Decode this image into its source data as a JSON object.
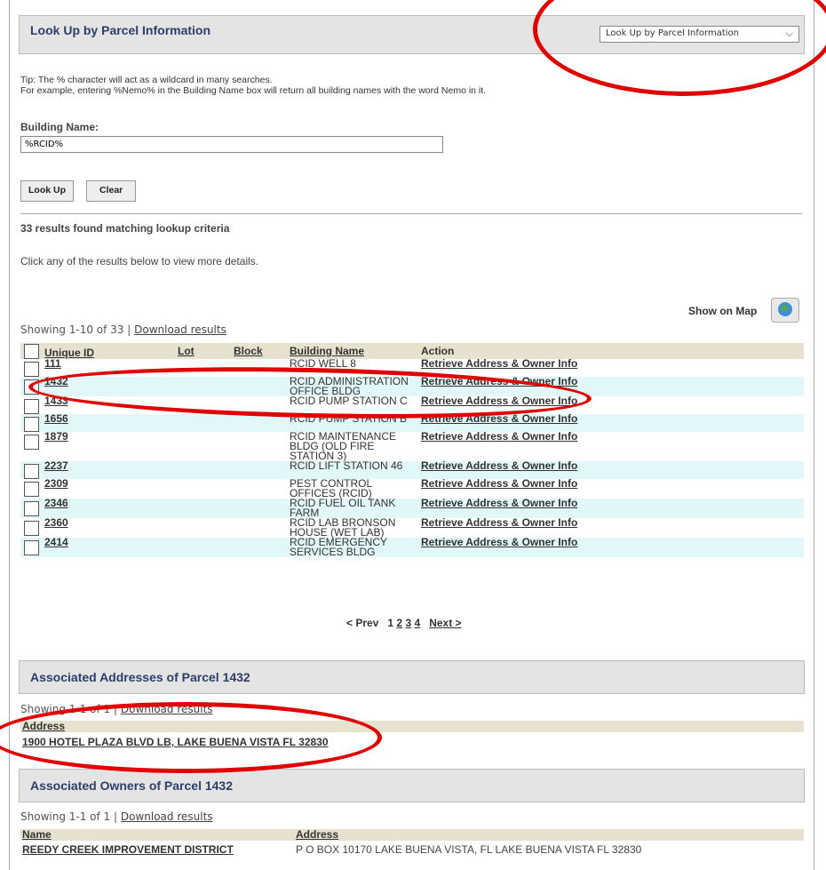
{
  "header": {
    "title": "Look Up by Parcel Information",
    "dropdown_value": "Look Up by Parcel Information"
  },
  "tip": {
    "line1": "Tip: The % character will act as a wildcard in many searches.",
    "line2": "For example, entering %Nemo% in the Building Name box will return all building names with the word Nemo in it."
  },
  "form": {
    "building_label": "Building Name:",
    "building_value": "%RCID%",
    "lookup_label": "Look Up",
    "clear_label": "Clear"
  },
  "results": {
    "count_text": "33 results found matching lookup criteria",
    "click_tip": "Click any of the results below to view more details.",
    "show_on_map": "Show on Map",
    "showing": "Showing 1-10 of 33 |",
    "download": "Download results",
    "columns": [
      "Unique ID",
      "Lot",
      "Block",
      "Building Name",
      "Action"
    ],
    "rows": [
      {
        "id": "111",
        "name": "RCID WELL 8",
        "action": "Retrieve Address & Owner Info"
      },
      {
        "id": "1432",
        "name": "RCID ADMINISTRATION OFFICE BLDG",
        "action": "Retrieve Address & Owner Info"
      },
      {
        "id": "1433",
        "name": "RCID PUMP STATION C",
        "action": "Retrieve Address & Owner Info"
      },
      {
        "id": "1656",
        "name": "RCID PUMP STATION B",
        "action": "Retrieve Address & Owner Info"
      },
      {
        "id": "1879",
        "name": "RCID MAINTENANCE BLDG (OLD FIRE STATION 3)",
        "action": "Retrieve Address & Owner Info"
      },
      {
        "id": "2237",
        "name": "RCID LIFT STATION 46",
        "action": "Retrieve Address & Owner Info"
      },
      {
        "id": "2309",
        "name": "PEST CONTROL OFFICES (RCID)",
        "action": "Retrieve Address & Owner Info"
      },
      {
        "id": "2346",
        "name": "RCID FUEL OIL TANK FARM",
        "action": "Retrieve Address & Owner Info"
      },
      {
        "id": "2360",
        "name": "RCID LAB BRONSON HOUSE (WET LAB)",
        "action": "Retrieve Address & Owner Info"
      },
      {
        "id": "2414",
        "name": "RCID EMERGENCY SERVICES BLDG",
        "action": "Retrieve Address & Owner Info"
      }
    ],
    "pager": {
      "prev": "< Prev",
      "pages": [
        "1",
        "2",
        "3",
        "4"
      ],
      "next": "Next >"
    }
  },
  "addresses": {
    "title": "Associated Addresses of Parcel 1432",
    "showing": "Showing 1-1 of 1 |",
    "download": "Download results",
    "col": "Address",
    "value": "1900 HOTEL PLAZA BLVD LB, LAKE BUENA VISTA FL 32830"
  },
  "owners": {
    "title": "Associated Owners of Parcel 1432",
    "showing": "Showing 1-1 of 1 |",
    "download": "Download results",
    "col_name": "Name",
    "col_address": "Address",
    "name": "REEDY CREEK IMPROVEMENT DISTRICT",
    "address": "P O BOX 10170 LAKE BUENA VISTA, FL LAKE BUENA VISTA FL 32830"
  },
  "annotation_color": "#e00000"
}
